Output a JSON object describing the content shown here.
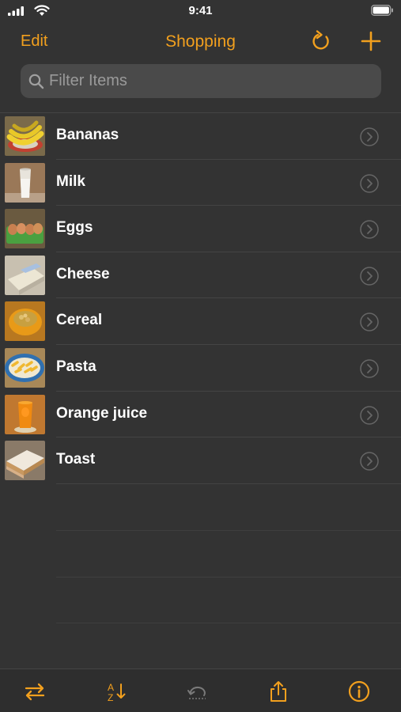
{
  "status": {
    "time": "9:41"
  },
  "nav": {
    "edit_label": "Edit",
    "title": "Shopping"
  },
  "search": {
    "placeholder": "Filter Items",
    "value": ""
  },
  "items": [
    {
      "label": "Bananas",
      "thumb": "bananas-photo"
    },
    {
      "label": "Milk",
      "thumb": "milk-photo"
    },
    {
      "label": "Eggs",
      "thumb": "eggs-photo"
    },
    {
      "label": "Cheese",
      "thumb": "cheese-photo"
    },
    {
      "label": "Cereal",
      "thumb": "cereal-photo"
    },
    {
      "label": "Pasta",
      "thumb": "pasta-photo"
    },
    {
      "label": "Orange juice",
      "thumb": "orange-juice-photo"
    },
    {
      "label": "Toast",
      "thumb": "toast-photo"
    }
  ],
  "toolbar": {
    "buttons": [
      "swap-arrows-icon",
      "sort-az-icon",
      "undo-icon",
      "share-icon",
      "info-icon"
    ]
  },
  "colors": {
    "accent": "#f2a01e",
    "background": "#333333",
    "search_bg": "#4a4a4a"
  }
}
